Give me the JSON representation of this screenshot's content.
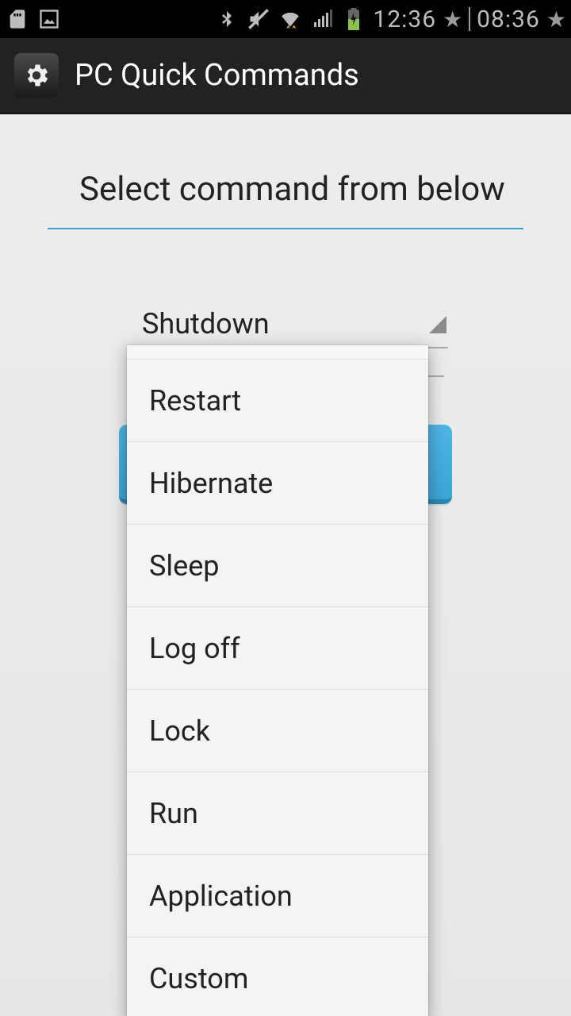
{
  "status": {
    "time1": "12:36",
    "time2": "08:36"
  },
  "actionbar": {
    "title": "PC Quick Commands"
  },
  "main": {
    "heading": "Select command from below",
    "spinner_selected": "Shutdown"
  },
  "dropdown": {
    "items": [
      {
        "label": "Restart"
      },
      {
        "label": "Hibernate"
      },
      {
        "label": "Sleep"
      },
      {
        "label": "Log off"
      },
      {
        "label": "Lock"
      },
      {
        "label": "Run"
      },
      {
        "label": "Application"
      },
      {
        "label": "Custom"
      }
    ]
  }
}
